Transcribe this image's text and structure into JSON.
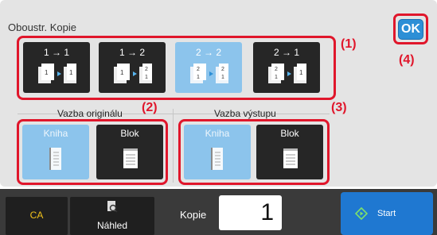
{
  "panel": {
    "title": "Oboustr. Kopie",
    "ok_label": "OK"
  },
  "callouts": {
    "modes": "(1)",
    "original_binding": "(2)",
    "output_binding": "(3)",
    "ok": "(4)"
  },
  "modes": [
    {
      "label": "1 → 1",
      "state": "normal",
      "icon": "one-sided-to-one-sided-icon"
    },
    {
      "label": "1 → 2",
      "state": "normal",
      "icon": "one-sided-to-two-sided-icon"
    },
    {
      "label": "2 → 2",
      "state": "selected",
      "icon": "two-sided-to-two-sided-icon"
    },
    {
      "label": "2 → 1",
      "state": "normal",
      "icon": "two-sided-to-one-sided-icon"
    }
  ],
  "original_binding": {
    "label": "Vazba originálu",
    "options": [
      {
        "label": "Kniha",
        "state": "selected",
        "icon": "book-binding-icon"
      },
      {
        "label": "Blok",
        "state": "normal",
        "icon": "tablet-binding-icon"
      }
    ]
  },
  "output_binding": {
    "label": "Vazba výstupu",
    "options": [
      {
        "label": "Kniha",
        "state": "selected",
        "icon": "book-binding-icon"
      },
      {
        "label": "Blok",
        "state": "normal",
        "icon": "tablet-binding-icon"
      }
    ]
  },
  "bottom_bar": {
    "ca_label": "CA",
    "preview_label": "Náhled",
    "preview_icon": "preview-magnifier-icon",
    "copies_label": "Kopie",
    "copies_value": "1",
    "start_label": "Start",
    "start_icon": "start-diamond-icon"
  },
  "colors": {
    "callout_red": "#e0162b",
    "selected_blue": "#8cc4ec",
    "ok_blue": "#2d8fd6",
    "start_blue": "#1f78d1",
    "ca_yellow": "#f1c21b"
  }
}
